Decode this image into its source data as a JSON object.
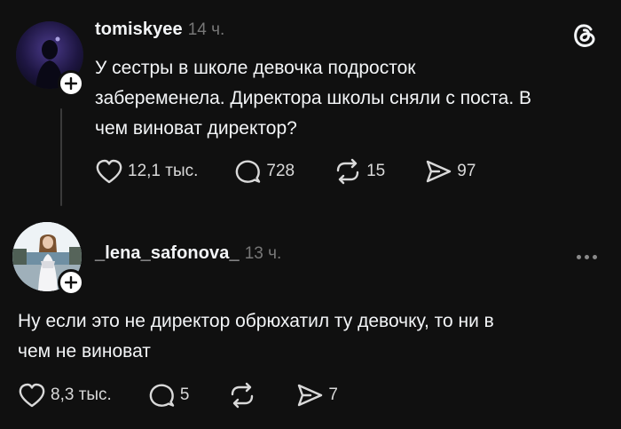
{
  "post": {
    "username": "tomiskyee",
    "time": "14 ч.",
    "text_lines": [
      "У сестры в школе девочка подросток",
      "забеременела. Директора школы сняли с поста. В",
      "чем виноват директор?"
    ],
    "likes": "12,1 тыс.",
    "comments": "728",
    "reposts": "15",
    "shares": "97"
  },
  "reply": {
    "username": "_lena_safonova_",
    "time": "13 ч.",
    "text_lines": [
      "Ну если это не директор обрюхатил ту девочку, то ни в",
      "чем не виноват"
    ],
    "likes": "8,3 тыс.",
    "comments": "5",
    "shares": "7"
  },
  "colors": {
    "background": "#101010",
    "text": "#f3f5f7",
    "muted": "#777777"
  },
  "icons": [
    "threads-logo-icon",
    "heart-icon",
    "comment-icon",
    "repost-icon",
    "share-icon",
    "plus-icon",
    "more-icon"
  ]
}
